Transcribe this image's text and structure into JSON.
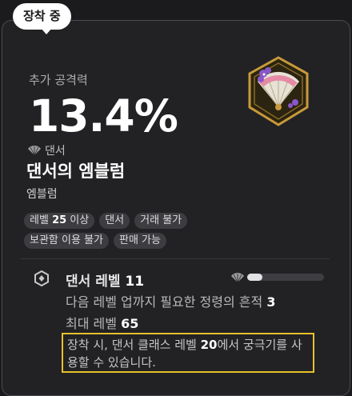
{
  "badge": "장착 중",
  "stat": {
    "label": "추가 공격력",
    "value": "13.4%"
  },
  "item": {
    "class_label": "댄서",
    "name": "댄서의 엠블럼",
    "type": "엠블럼",
    "icon": "fan-emblem-icon"
  },
  "tags": [
    {
      "pre": "레벨 ",
      "bold": "25",
      "post": " 이상"
    },
    {
      "pre": "댄서",
      "bold": "",
      "post": ""
    },
    {
      "pre": "거래 불가",
      "bold": "",
      "post": ""
    },
    {
      "pre": "보관함 이용 불가",
      "bold": "",
      "post": ""
    },
    {
      "pre": "판매 가능",
      "bold": "",
      "post": ""
    }
  ],
  "level_section": {
    "title_pre": "댄서 레벨 ",
    "title_num": "11",
    "progress": 0.2,
    "line1_pre": "다음 레벨 업까지 필요한 정령의 흔적 ",
    "line1_num": "3",
    "line2_pre": "최대 레벨 ",
    "line2_num": "65",
    "note_pre": "장착 시, 댄서 클래스 레벨 ",
    "note_num": "20",
    "note_post": "에서 궁극기를 사용할 수 있습니다."
  },
  "colors": {
    "highlight": "#e8c02a",
    "card_bg": "#222225",
    "border": "#4c4c50"
  }
}
